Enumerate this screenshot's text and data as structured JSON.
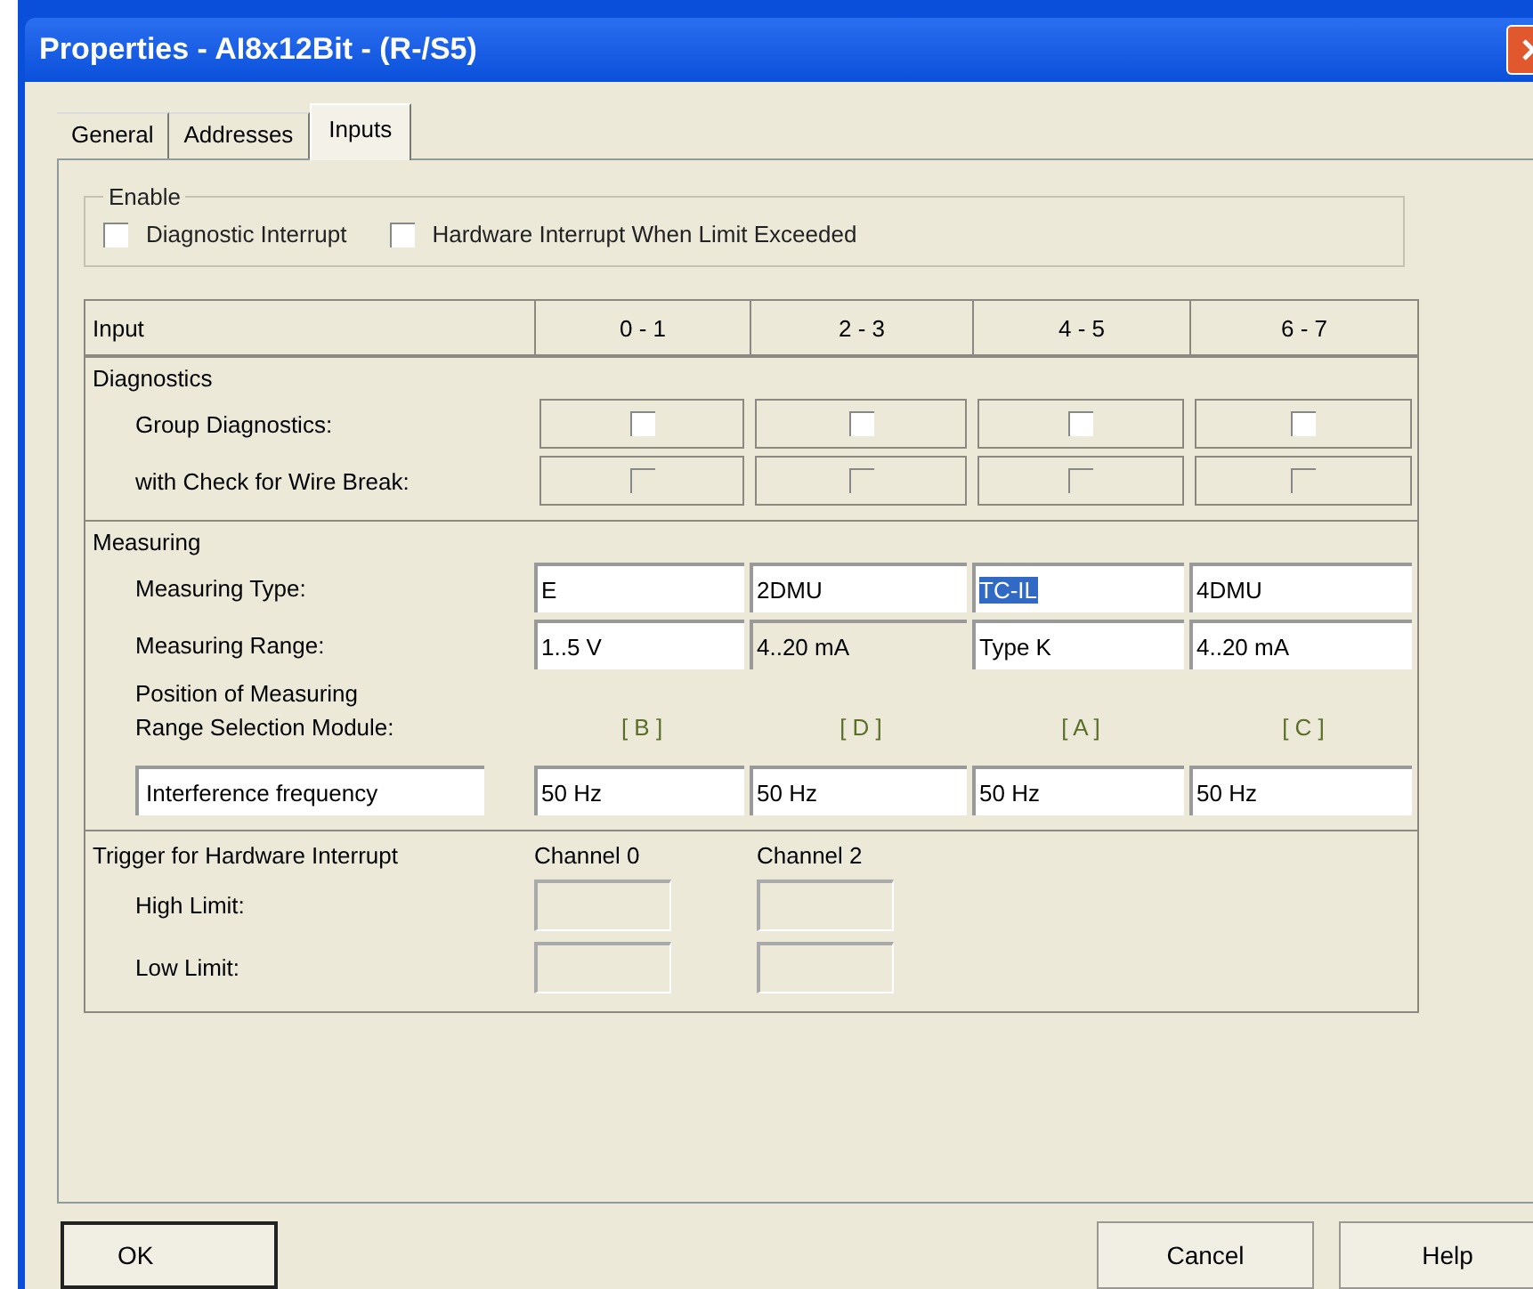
{
  "window": {
    "title": "Properties - AI8x12Bit - (R-/S5)"
  },
  "tabs": [
    {
      "label": "General",
      "selected": false
    },
    {
      "label": "Addresses",
      "selected": false
    },
    {
      "label": "Inputs",
      "selected": true
    }
  ],
  "enable": {
    "title": "Enable",
    "options": [
      {
        "label": "Diagnostic Interrupt",
        "checked": false
      },
      {
        "label": "Hardware Interrupt When Limit Exceeded",
        "checked": false
      }
    ]
  },
  "table": {
    "header": "Input",
    "columns": [
      "0 - 1",
      "2 - 3",
      "4 - 5",
      "6 - 7"
    ],
    "diagnostics": {
      "title": "Diagnostics",
      "rows": [
        {
          "label": "Group Diagnostics:",
          "cells": [
            {
              "checked": false,
              "disabled": false
            },
            {
              "checked": false,
              "disabled": false
            },
            {
              "checked": false,
              "disabled": false
            },
            {
              "checked": false,
              "disabled": false
            }
          ]
        },
        {
          "label": "with Check for Wire Break:",
          "cells": [
            {
              "checked": false,
              "disabled": true
            },
            {
              "checked": false,
              "disabled": true
            },
            {
              "checked": false,
              "disabled": true
            },
            {
              "checked": false,
              "disabled": true
            }
          ]
        }
      ]
    },
    "measuring": {
      "title": "Measuring",
      "type": {
        "label": "Measuring Type:",
        "fields": [
          {
            "value": "E",
            "selected": false,
            "disabled": false
          },
          {
            "value": "2DMU",
            "selected": false,
            "disabled": false
          },
          {
            "value": "TC-IL",
            "selected": true,
            "disabled": false
          },
          {
            "value": "4DMU",
            "selected": false,
            "disabled": false
          }
        ]
      },
      "range": {
        "label": "Measuring Range:",
        "fields": [
          {
            "value": "1..5 V",
            "selected": false,
            "disabled": false
          },
          {
            "value": "4..20 mA",
            "selected": false,
            "disabled": true
          },
          {
            "value": "Type K",
            "selected": false,
            "disabled": false
          },
          {
            "value": "4..20 mA",
            "selected": false,
            "disabled": false
          }
        ]
      },
      "position": {
        "label_lines": [
          "Position of Measuring",
          "Range Selection Module:"
        ],
        "values": [
          "[ B ]",
          "[ D ]",
          "[ A ]",
          "[ C ]"
        ]
      },
      "interference": {
        "label": "Interference frequency",
        "fields": [
          "50 Hz",
          "50 Hz",
          "50 Hz",
          "50 Hz"
        ]
      }
    },
    "trigger": {
      "title": "Trigger for Hardware Interrupt",
      "row_labels": [
        "High Limit:",
        "Low Limit:"
      ],
      "channels": [
        {
          "label": "Channel 0",
          "disabled": true
        },
        {
          "label": "Channel 2",
          "disabled": true
        }
      ]
    }
  },
  "buttons": [
    {
      "label": "OK",
      "kind": "default"
    },
    {
      "label": "Cancel",
      "kind": "normal"
    },
    {
      "label": "Help",
      "kind": "normal"
    }
  ]
}
